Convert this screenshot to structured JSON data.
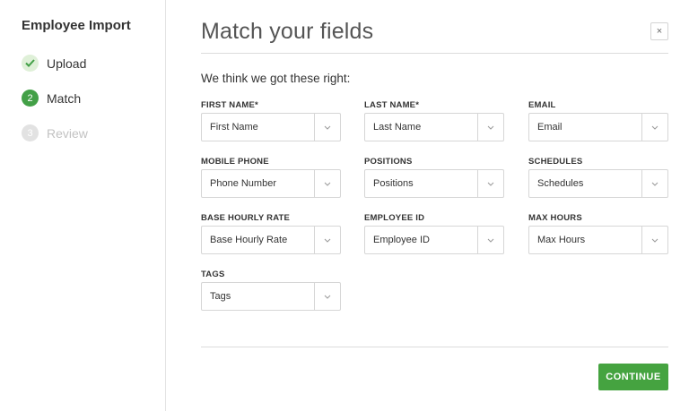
{
  "sidebar": {
    "title": "Employee Import",
    "steps": [
      {
        "number": "",
        "label": "Upload",
        "state": "done",
        "icon": "check-icon"
      },
      {
        "number": "2",
        "label": "Match",
        "state": "active"
      },
      {
        "number": "3",
        "label": "Review",
        "state": "pending"
      }
    ]
  },
  "main": {
    "title": "Match your fields",
    "close_icon": "×",
    "intro": "We think we got these right:",
    "fields": [
      {
        "label": "FIRST NAME*",
        "value": "First Name"
      },
      {
        "label": "LAST NAME*",
        "value": "Last Name"
      },
      {
        "label": "EMAIL",
        "value": "Email"
      },
      {
        "label": "MOBILE PHONE",
        "value": "Phone Number"
      },
      {
        "label": "POSITIONS",
        "value": "Positions"
      },
      {
        "label": "SCHEDULES",
        "value": "Schedules"
      },
      {
        "label": "BASE HOURLY RATE",
        "value": "Base Hourly Rate"
      },
      {
        "label": "EMPLOYEE ID",
        "value": "Employee ID"
      },
      {
        "label": "MAX HOURS",
        "value": "Max Hours"
      },
      {
        "label": "TAGS",
        "value": "Tags"
      }
    ],
    "continue_label": "CONTINUE"
  },
  "colors": {
    "accent_green": "#45a340",
    "done_step_bg": "#dff0d8",
    "pending_step": "#c2c2c2"
  }
}
